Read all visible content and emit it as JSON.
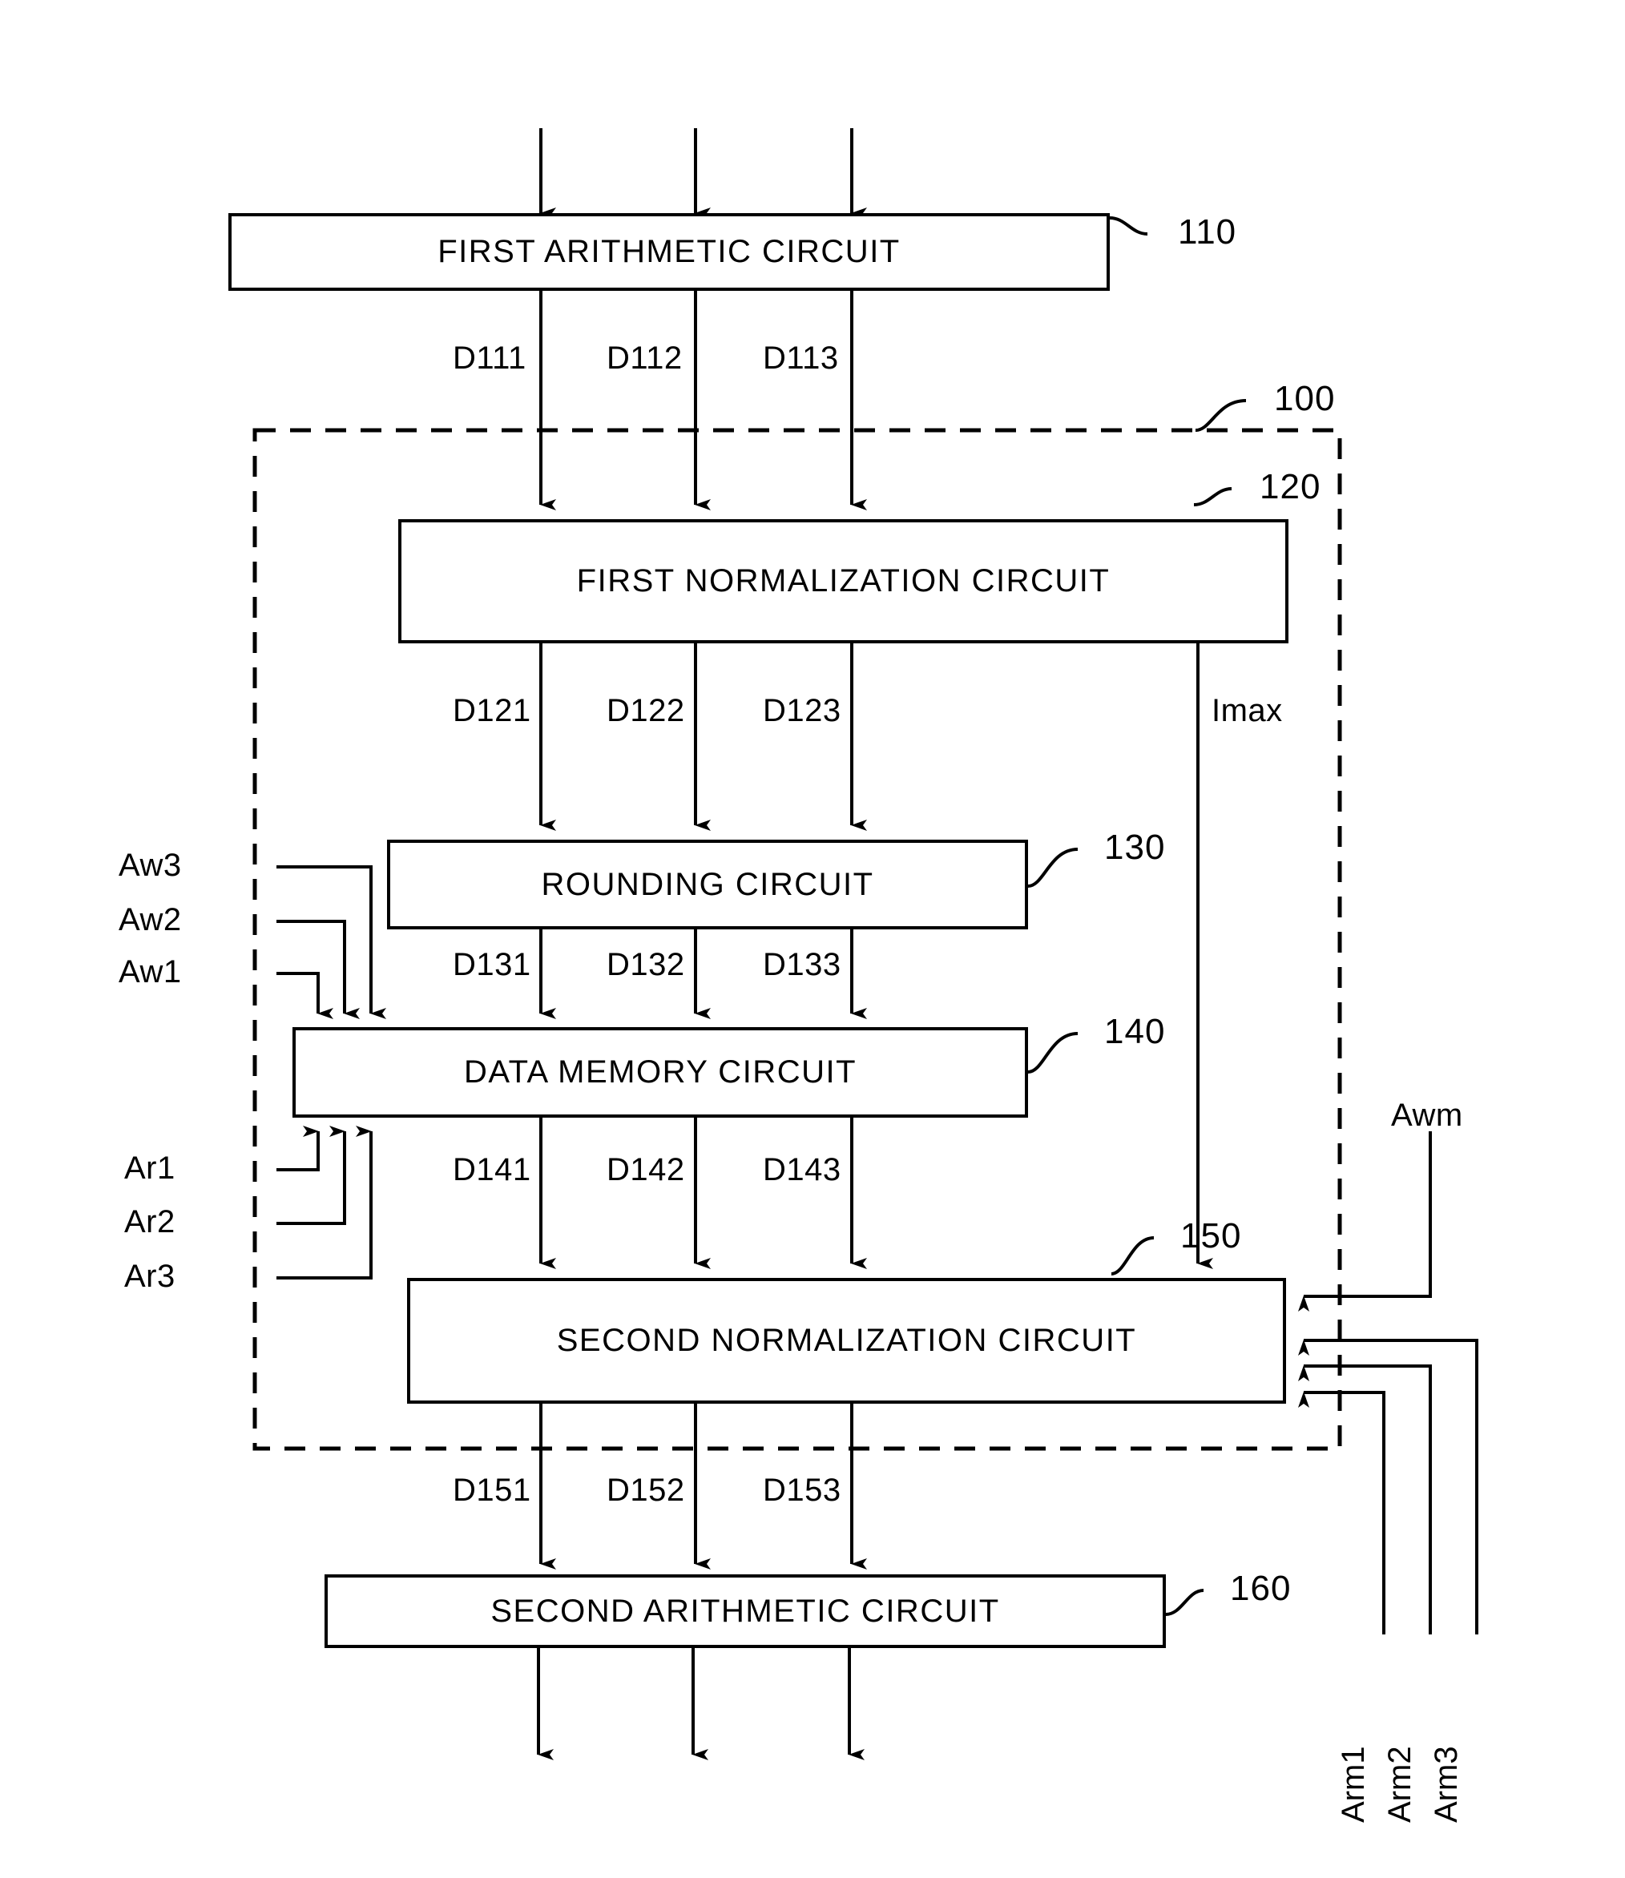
{
  "figure": {
    "type": "patent-block-diagram",
    "background": "#ffffff",
    "line_color": "#000000"
  },
  "blocks": [
    {
      "id": "110",
      "label": "FIRST ARITHMETIC CIRCUIT",
      "ref": "110"
    },
    {
      "id": "120",
      "label": "FIRST NORMALIZATION CIRCUIT",
      "ref": "120"
    },
    {
      "id": "130",
      "label": "ROUNDING CIRCUIT",
      "ref": "130"
    },
    {
      "id": "140",
      "label": "DATA MEMORY CIRCUIT",
      "ref": "140"
    },
    {
      "id": "150",
      "label": "SECOND NORMALIZATION CIRCUIT",
      "ref": "150"
    },
    {
      "id": "160",
      "label": "SECOND ARITHMETIC CIRCUIT",
      "ref": "160"
    }
  ],
  "enclosure": {
    "ref": "100",
    "style": "dashed"
  },
  "bus_labels": {
    "from_110": [
      "D111",
      "D112",
      "D113"
    ],
    "from_120": [
      "D121",
      "D122",
      "D123"
    ],
    "from_130": [
      "D131",
      "D132",
      "D133"
    ],
    "from_140": [
      "D141",
      "D142",
      "D143"
    ],
    "from_150": [
      "D151",
      "D152",
      "D153"
    ]
  },
  "signals": {
    "imax": "Imax",
    "write_addresses": [
      "Aw1",
      "Aw2",
      "Aw3"
    ],
    "read_addresses": [
      "Ar1",
      "Ar2",
      "Ar3"
    ],
    "awm": "Awm",
    "arm": [
      "Arm1",
      "Arm2",
      "Arm3"
    ]
  }
}
